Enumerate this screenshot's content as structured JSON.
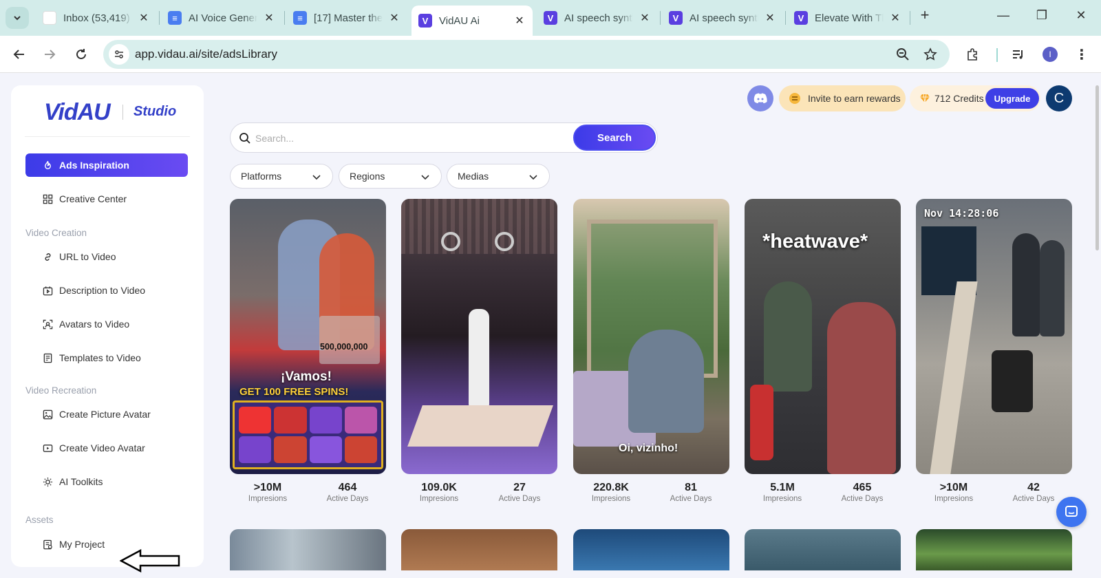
{
  "browser": {
    "tabs": [
      {
        "label": "Inbox (53,419)",
        "favicon": "gmail-icon",
        "active": false
      },
      {
        "label": "AI Voice Generator",
        "favicon": "docs-icon",
        "active": false
      },
      {
        "label": "[17] Master the",
        "favicon": "docs-icon",
        "active": false
      },
      {
        "label": "VidAU Ai",
        "favicon": "vidau-icon",
        "active": true
      },
      {
        "label": "AI speech synthesis",
        "favicon": "vidau-icon",
        "active": false
      },
      {
        "label": "AI speech synthesis",
        "favicon": "vidau-icon",
        "active": false
      },
      {
        "label": "Elevate With The",
        "favicon": "vidau-icon",
        "active": false
      }
    ],
    "url": "app.vidau.ai/site/adsLibrary",
    "profile_initial": "I"
  },
  "sidebar": {
    "logo": "VidAU",
    "logo_sub": "Studio",
    "items": [
      {
        "label": "Ads Inspiration",
        "icon": "flame-icon",
        "active": true
      },
      {
        "label": "Creative Center",
        "icon": "grid-icon"
      },
      {
        "label": "URL to Video",
        "icon": "link-icon"
      },
      {
        "label": "Description to Video",
        "icon": "document-video-icon"
      },
      {
        "label": "Avatars to Video",
        "icon": "avatar-frame-icon"
      },
      {
        "label": "Templates to Video",
        "icon": "template-icon"
      },
      {
        "label": "Create Picture Avatar",
        "icon": "image-icon"
      },
      {
        "label": "Create Video Avatar",
        "icon": "video-icon"
      },
      {
        "label": "AI Toolkits",
        "icon": "sparkle-sun-icon"
      },
      {
        "label": "My Project",
        "icon": "project-icon"
      }
    ],
    "sections": {
      "video_creation": "Video Creation",
      "video_recreation": "Video Recreation",
      "assets": "Assets"
    }
  },
  "header": {
    "invite": "Invite to earn rewards",
    "credits": "712 Credits",
    "upgrade": "Upgrade",
    "avatar_initial": "C"
  },
  "search": {
    "placeholder": "Search...",
    "button": "Search"
  },
  "filters": [
    "Platforms",
    "Regions",
    "Medias"
  ],
  "cards": [
    {
      "impressions": ">10M",
      "active_days": "464",
      "caption": "¡Vamos!",
      "caption2": "GET 100 FREE SPINS!",
      "amount": "500,000,000"
    },
    {
      "impressions": "109.0K",
      "active_days": "27"
    },
    {
      "impressions": "220.8K",
      "active_days": "81",
      "caption": "Oi, vizinho!"
    },
    {
      "impressions": "5.1M",
      "active_days": "465",
      "caption": "*heatwave*"
    },
    {
      "impressions": ">10M",
      "active_days": "42",
      "caption": "Nov 14:28:06"
    }
  ],
  "labels": {
    "impressions": "Impresions",
    "active_days": "Active Days"
  },
  "colors": {
    "accent": "#3e3fe6",
    "tabbar": "#d3ecea",
    "invite_bg": "#fbe4b8"
  }
}
